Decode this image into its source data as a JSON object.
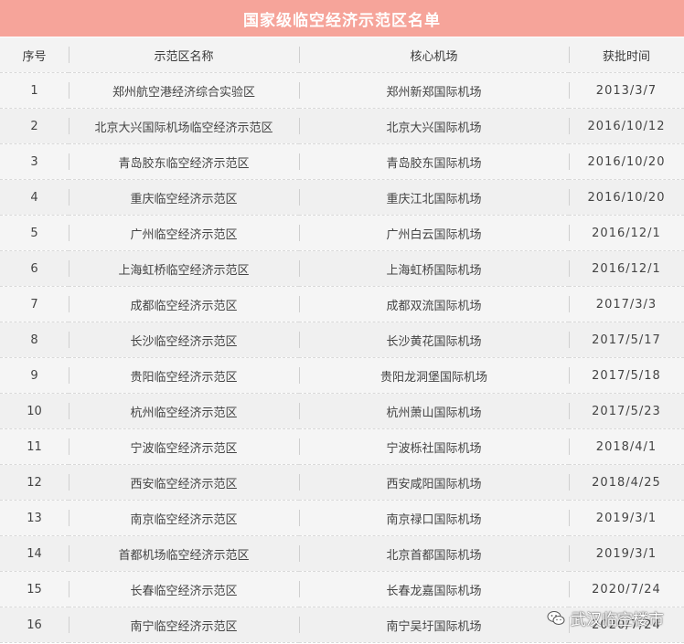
{
  "title": "国家级临空经济示范区名单",
  "columns": [
    "序号",
    "示范区名称",
    "核心机场",
    "获批时间"
  ],
  "rows": [
    [
      "1",
      "郑州航空港经济综合实验区",
      "郑州新郑国际机场",
      "2013/3/7"
    ],
    [
      "2",
      "北京大兴国际机场临空经济示范区",
      "北京大兴国际机场",
      "2016/10/12"
    ],
    [
      "3",
      "青岛胶东临空经济示范区",
      "青岛胶东国际机场",
      "2016/10/20"
    ],
    [
      "4",
      "重庆临空经济示范区",
      "重庆江北国际机场",
      "2016/10/20"
    ],
    [
      "5",
      "广州临空经济示范区",
      "广州白云国际机场",
      "2016/12/1"
    ],
    [
      "6",
      "上海虹桥临空经济示范区",
      "上海虹桥国际机场",
      "2016/12/1"
    ],
    [
      "7",
      "成都临空经济示范区",
      "成都双流国际机场",
      "2017/3/3"
    ],
    [
      "8",
      "长沙临空经济示范区",
      "长沙黄花国际机场",
      "2017/5/17"
    ],
    [
      "9",
      "贵阳临空经济示范区",
      "贵阳龙洞堡国际机场",
      "2017/5/18"
    ],
    [
      "10",
      "杭州临空经济示范区",
      "杭州萧山国际机场",
      "2017/5/23"
    ],
    [
      "11",
      "宁波临空经济示范区",
      "宁波栎社国际机场",
      "2018/4/1"
    ],
    [
      "12",
      "西安临空经济示范区",
      "西安咸阳国际机场",
      "2018/4/25"
    ],
    [
      "13",
      "南京临空经济示范区",
      "南京禄口国际机场",
      "2019/3/1"
    ],
    [
      "14",
      "首都机场临空经济示范区",
      "北京首都国际机场",
      "2019/3/1"
    ],
    [
      "15",
      "长春临空经济示范区",
      "长春龙嘉国际机场",
      "2020/7/24"
    ],
    [
      "16",
      "南宁临空经济示范区",
      "南宁吴圩国际机场",
      "2020/7/24"
    ]
  ],
  "watermark": {
    "text": "武汉临空楼市",
    "icon": "wechat-icon"
  },
  "colors": {
    "title_bg": "#f6a49a",
    "title_text": "#ffffff"
  }
}
